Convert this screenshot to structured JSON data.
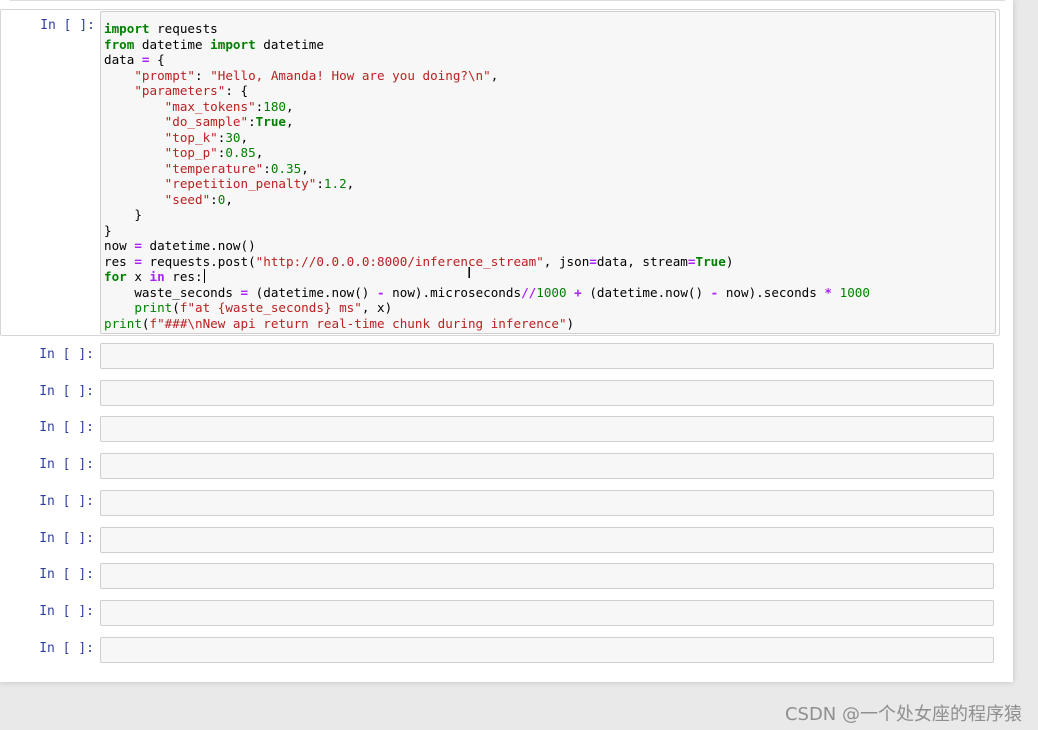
{
  "cells": {
    "active": {
      "prompt": "In [ ]:",
      "code_lines": [
        "import requests",
        "from datetime import datetime",
        "data = {",
        "    \"prompt\": \"Hello, Amanda! How are you doing?\\n\",",
        "    \"parameters\": {",
        "        \"max_tokens\":180,",
        "        \"do_sample\":True,",
        "        \"top_k\":30,",
        "        \"top_p\":0.85,",
        "        \"temperature\":0.35,",
        "        \"repetition_penalty\":1.2,",
        "        \"seed\":0,",
        "    }",
        "}",
        "now = datetime.now()",
        "res = requests.post(\"http://0.0.0.0:8000/inference_stream\", json=data, stream=True)",
        "for x in res:",
        "    waste_seconds = (datetime.now() - now).microseconds//1000 + (datetime.now() - now).seconds * 1000",
        "    print(f\"at {waste_seconds} ms\", x)",
        "print(f\"###\\nNew api return real-time chunk during inference\")"
      ]
    },
    "empty_cells": [
      {
        "prompt": "In [ ]:"
      },
      {
        "prompt": "In [ ]:"
      },
      {
        "prompt": "In [ ]:"
      },
      {
        "prompt": "In [ ]:"
      },
      {
        "prompt": "In [ ]:"
      },
      {
        "prompt": "In [ ]:"
      },
      {
        "prompt": "In [ ]:"
      },
      {
        "prompt": "In [ ]:"
      },
      {
        "prompt": "In [ ]:"
      }
    ]
  },
  "watermark": "CSDN @一个处女座的程序猿",
  "colors": {
    "prompt": "#303f9f",
    "keyword": "#008000",
    "string": "#ba2121",
    "operator": "#aa22ff",
    "cell_background": "#f7f7f7"
  }
}
